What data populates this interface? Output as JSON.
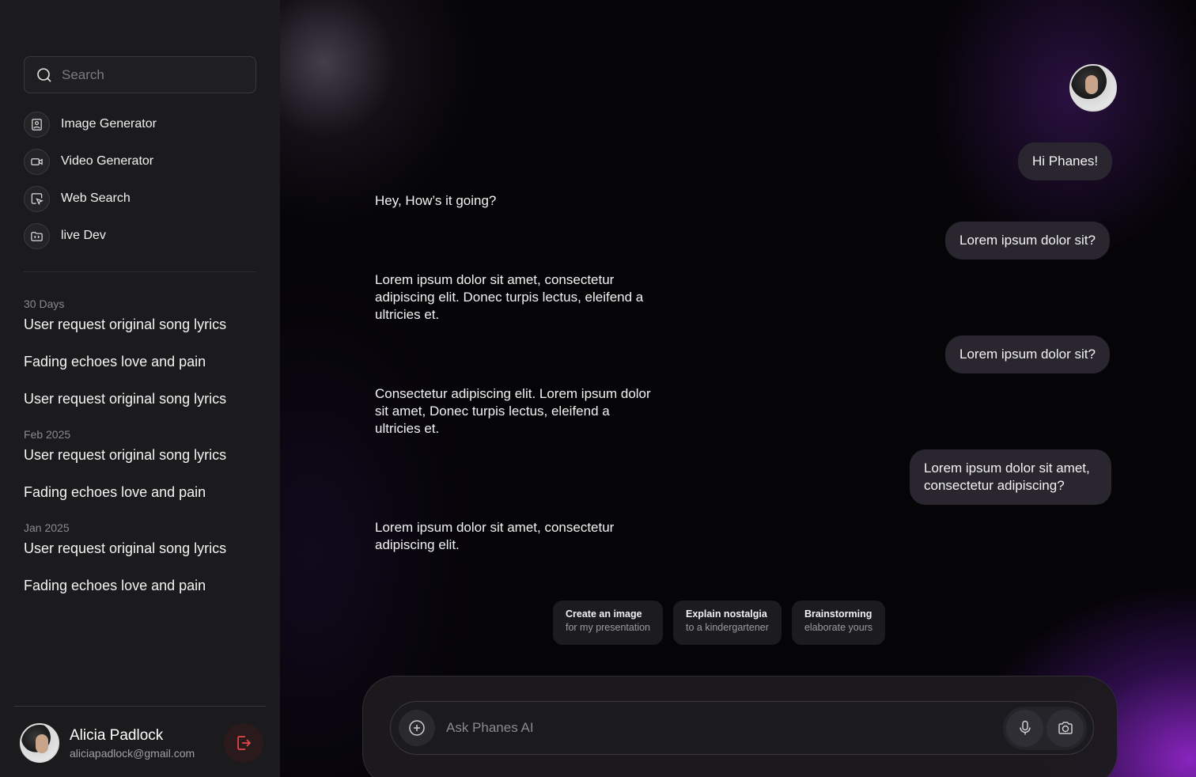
{
  "search": {
    "placeholder": "Search"
  },
  "tools": [
    {
      "label": "Image Generator",
      "icon": "image-icon"
    },
    {
      "label": "Video Generator",
      "icon": "video-icon"
    },
    {
      "label": "Web Search",
      "icon": "web-search-icon"
    },
    {
      "label": "live Dev",
      "icon": "code-folder-icon"
    }
  ],
  "history": [
    {
      "title": "30 Days",
      "items": [
        "User request original song lyrics",
        "Fading echoes love and pain",
        "User request original song lyrics"
      ]
    },
    {
      "title": "Feb 2025",
      "items": [
        "User request original song lyrics",
        "Fading echoes love and pain"
      ]
    },
    {
      "title": "Jan 2025",
      "items": [
        "User request original song lyrics",
        "Fading echoes love and pain"
      ]
    }
  ],
  "user": {
    "name": "Alicia Padlock",
    "email": "aliciapadlock@gmail.com"
  },
  "chat": {
    "messages": [
      {
        "side": "right",
        "text": "Hi Phanes!"
      },
      {
        "side": "left",
        "text": "Hey, How’s it going?"
      },
      {
        "side": "right",
        "text": "Lorem ipsum dolor sit?"
      },
      {
        "side": "left",
        "text": "Lorem ipsum dolor sit amet, consectetur adipiscing elit. Donec turpis lectus, eleifend a ultricies et."
      },
      {
        "side": "right",
        "text": "Lorem ipsum dolor sit?"
      },
      {
        "side": "left",
        "text": "Consectetur adipiscing elit. Lorem ipsum dolor sit amet, Donec turpis lectus, eleifend a ultricies et."
      },
      {
        "side": "right",
        "text": "Lorem ipsum dolor sit amet, consectetur adipiscing?"
      },
      {
        "side": "left",
        "text": "Lorem ipsum dolor sit amet, consectetur adipiscing elit."
      }
    ]
  },
  "suggestions": [
    {
      "title": "Create an image",
      "subtitle": "for my presentation"
    },
    {
      "title": "Explain nostalgia",
      "subtitle": "to a kindergartener"
    },
    {
      "title": "Brainstorming",
      "subtitle": "elaborate yours"
    }
  ],
  "composer": {
    "placeholder": "Ask Phanes AI"
  },
  "colors": {
    "accent": "#8a2be2",
    "logout": "#e5484d"
  }
}
